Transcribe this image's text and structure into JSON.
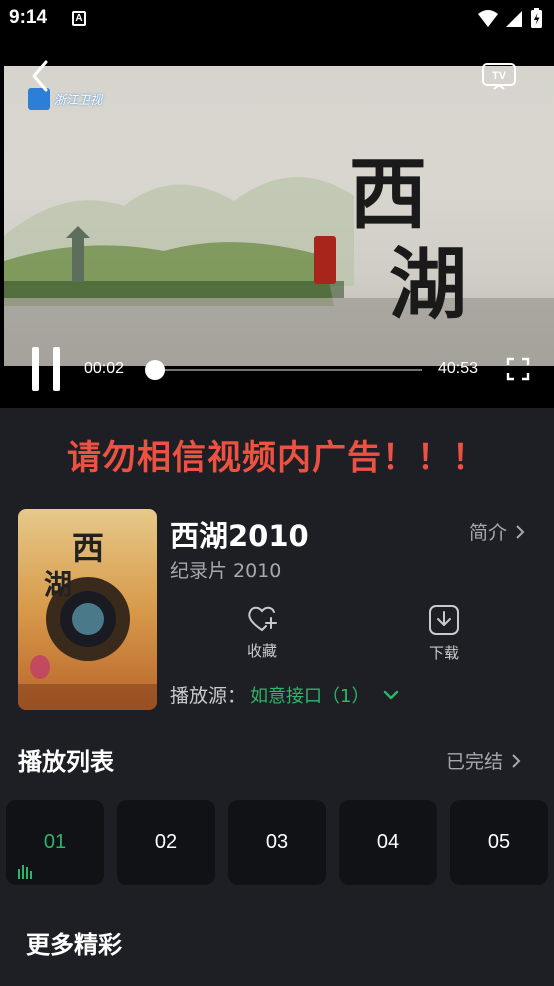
{
  "status_bar": {
    "time": "9:14",
    "notification_icon_letter": "A",
    "icons": [
      "wifi-icon",
      "signal-icon",
      "battery-charging-icon"
    ]
  },
  "player": {
    "channel_logo_text": "浙江卫视",
    "video_title_art": "西湖",
    "current_time": "00:02",
    "total_time": "40:53",
    "progress": 0.0008,
    "icons": [
      "back-icon",
      "tv-cast-icon",
      "pause-icon",
      "fullscreen-icon"
    ]
  },
  "warning": "请勿相信视频内广告！！！",
  "info": {
    "title": "西湖2010",
    "meta": "纪录片  2010",
    "intro_label": "简介",
    "favorite_label": "收藏",
    "download_label": "下载",
    "source_label": "播放源：",
    "source_value": "如意接口（1）"
  },
  "playlist": {
    "title": "播放列表",
    "status": "已完结",
    "episodes": [
      "01",
      "02",
      "03",
      "04",
      "05"
    ],
    "active_episode": "01"
  },
  "more": {
    "title": "更多精彩"
  },
  "colors": {
    "accent_green": "#2fb46c",
    "warning_red": "#ec5142",
    "background": "#1e1f24"
  }
}
